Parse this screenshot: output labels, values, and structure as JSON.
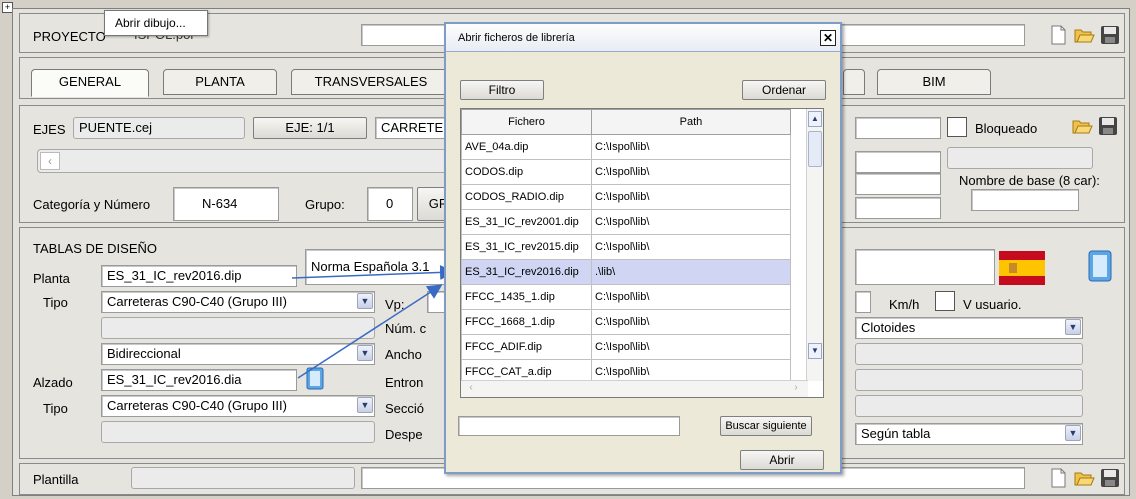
{
  "tooltip": {
    "text": "Abrir dibujo..."
  },
  "header": {
    "proyecto_label": "PROYECTO",
    "proyecto_value": "ISPOL.pol"
  },
  "tabs": [
    "GENERAL",
    "PLANTA",
    "TRANSVERSALES",
    "BIM"
  ],
  "ejes": {
    "label": "EJES",
    "file": "PUENTE.cej",
    "eje_button": "EJE: 1/1",
    "carretera_label": "CARRETE",
    "bloqueado_label": "Bloqueado",
    "nombre_base_label": "Nombre de base (8 car):",
    "categoria_label": "Categoría y Número",
    "categoria_value": "N-634",
    "grupo_label": "Grupo:",
    "grupo_value": "0",
    "gr_button": "GR"
  },
  "tablas": {
    "title": "TABLAS DE DISEÑO",
    "planta_label": "Planta",
    "planta_value": "ES_31_IC_rev2016.dip",
    "norma_text": "Norma Española 3.1",
    "tipo_label": "Tipo",
    "tipo_planta_value": "Carreteras C90-C40 (Grupo III)",
    "vp_label": "Vp:",
    "num_label": "Núm. c",
    "bidireccional": "Bidireccional",
    "ancho_label": "Ancho",
    "alzado_label": "Alzado",
    "alzado_value": "ES_31_IC_rev2016.dia",
    "entron_label": "Entron",
    "tipo_alzado_value": "Carreteras C90-C40 (Grupo III)",
    "seccion_label": "Secció",
    "desp_label": "Despe",
    "kmh_label": "Km/h",
    "v_usuario_label": "V usuario.",
    "clotoides": "Clotoides",
    "segun_tabla": "Según tabla"
  },
  "plantilla": {
    "label": "Plantilla"
  },
  "dialog": {
    "title": "Abrir ficheros de librería",
    "close_glyph": "✕",
    "filtro_button": "Filtro",
    "ordenar_button": "Ordenar",
    "columns": [
      "Fichero",
      "Path"
    ],
    "rows": [
      {
        "fichero": "AVE_04a.dip",
        "path": "C:\\Ispol\\lib\\"
      },
      {
        "fichero": "CODOS.dip",
        "path": "C:\\Ispol\\lib\\"
      },
      {
        "fichero": "CODOS_RADIO.dip",
        "path": "C:\\Ispol\\lib\\"
      },
      {
        "fichero": "ES_31_IC_rev2001.dip",
        "path": "C:\\Ispol\\lib\\"
      },
      {
        "fichero": "ES_31_IC_rev2015.dip",
        "path": "C:\\Ispol\\lib\\"
      },
      {
        "fichero": "ES_31_IC_rev2016.dip",
        "path": ".\\lib\\"
      },
      {
        "fichero": "FFCC_1435_1.dip",
        "path": "C:\\Ispol\\lib\\"
      },
      {
        "fichero": "FFCC_1668_1.dip",
        "path": "C:\\Ispol\\lib\\"
      },
      {
        "fichero": "FFCC_ADIF.dip",
        "path": "C:\\Ispol\\lib\\"
      },
      {
        "fichero": "FFCC_CAT_a.dip",
        "path": "C:\\Ispol\\lib\\"
      }
    ],
    "selected_row": 5,
    "search_value": "",
    "buscar_button": "Buscar siguiente",
    "abrir_button": "Abrir"
  },
  "icons": {
    "new": "new-document-icon",
    "open": "open-folder-icon",
    "save": "save-disk-icon",
    "flag": "spain-flag-icon",
    "notebook": "notebook-icon"
  },
  "colors": {
    "arrow": "#3a6bc4",
    "selection": "#cfd5f2",
    "dialog_border": "#7f9cc9"
  }
}
